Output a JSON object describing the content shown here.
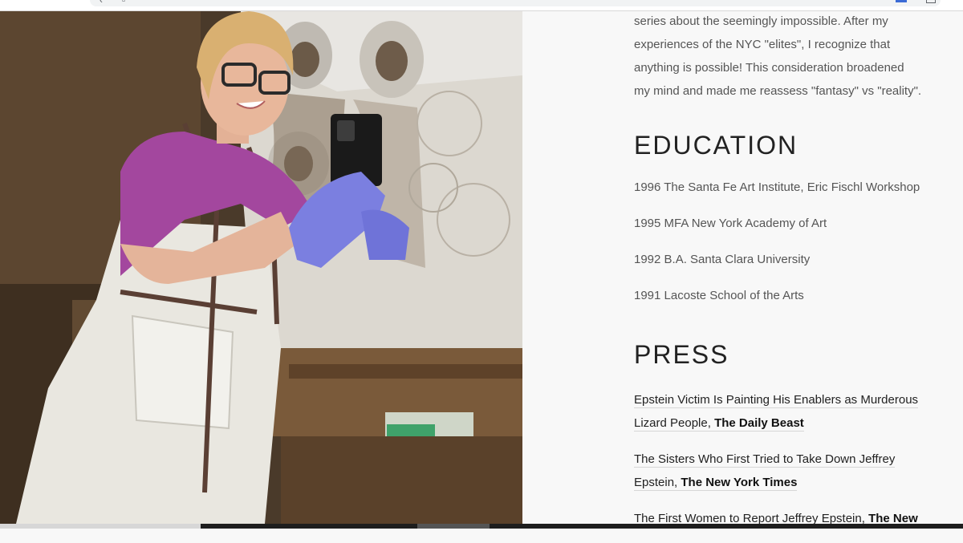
{
  "bio": {
    "lines": [
      "series about the seemingly impossible. After my",
      "experiences of the NYC \"elites\", I recognize that",
      "anything is possible! This consideration broadened",
      "my mind and made me reassess \"fantasy\" vs \"reality\"."
    ]
  },
  "education": {
    "heading": "EDUCATION",
    "items": [
      "1996 The Santa Fe Art Institute, Eric Fischl Workshop",
      "1995 MFA New York Academy of Art",
      "1992 B.A. Santa Clara University",
      "1991 Lacoste School of the Arts"
    ]
  },
  "press": {
    "heading": "PRESS",
    "items": [
      {
        "line1": "Epstein Victim Is Painting His Enablers as Murderous",
        "line2": "Lizard People,",
        "publication": "The Daily Beast"
      },
      {
        "line1": "The Sisters Who First Tried to Take Down Jeffrey",
        "line2": "Epstein,",
        "publication": "The New York Times"
      },
      {
        "line1": "The First Women to Report Jeffrey Epstein,",
        "line2": "",
        "publication": "The New"
      }
    ]
  },
  "colors": {
    "page_bg": "#f8f8f8",
    "heading": "#222222",
    "body_text": "#555555",
    "glove": "#7b7fe0",
    "shirt": "#a3479e"
  },
  "icons": [
    "back-arrow-icon",
    "page-icon",
    "extension-icon",
    "window-icon"
  ]
}
